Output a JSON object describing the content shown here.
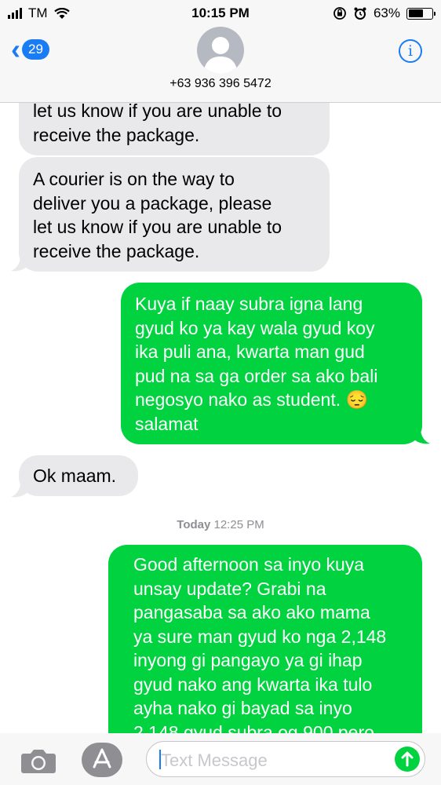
{
  "status_bar": {
    "carrier": "TM",
    "time": "10:15 PM",
    "battery": "63%"
  },
  "header": {
    "back_badge": "29",
    "contact": "+63 936 396 5472"
  },
  "messages": [
    {
      "direction": "received",
      "text": "let us know if you are unable to\nreceive the package."
    },
    {
      "direction": "received",
      "text": "A courier is on the way to\ndeliver you a package, please\nlet us know if you are unable to\nreceive the package."
    },
    {
      "direction": "sent",
      "text": "Kuya if naay subra igna lang\ngyud ko ya kay wala gyud koy\nika puli ana, kwarta man gud\npud na sa ga order sa ako bali\nnegosyo nako as student. 😔\nsalamat"
    },
    {
      "direction": "received",
      "text": "Ok maam."
    },
    {
      "direction": "sent",
      "text": "Good afternoon sa inyo kuya\nunsay update? Grabi na\npangasaba sa ako ako mama\nya sure man gyud ko nga 2,148\ninyong gi pangayo ya gi ihap\ngyud nako ang kwarta ika tulo\nayha nako gi bayad sa inyo\n2,148 gyud subra og 900 pero"
    }
  ],
  "timestamp": {
    "day": "Today",
    "time": "12:25 PM"
  },
  "input": {
    "placeholder": "Text Message"
  },
  "colors": {
    "accent": "#1a7cf5",
    "sent_bubble": "#00d33f",
    "received_bubble": "#e9e9eb"
  }
}
